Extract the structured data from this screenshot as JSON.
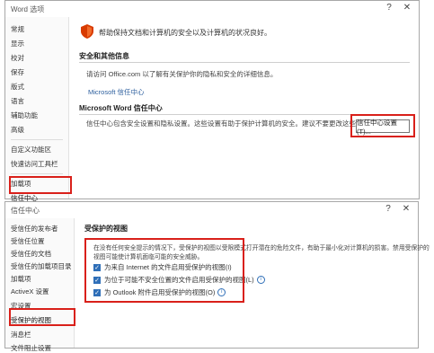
{
  "word_options": {
    "title": "Word 选项",
    "help_btn": "?",
    "close_btn": "✕",
    "sidebar": [
      {
        "label": "常规"
      },
      {
        "label": "显示"
      },
      {
        "label": "校对"
      },
      {
        "label": "保存"
      },
      {
        "label": "版式"
      },
      {
        "label": "语言"
      },
      {
        "label": "辅助功能"
      },
      {
        "label": "高级"
      },
      {
        "label": "自定义功能区"
      },
      {
        "label": "快速访问工具栏"
      },
      {
        "label": "加载项"
      },
      {
        "label": "信任中心"
      }
    ],
    "banner_text": "帮助保持文档和计算机的安全以及计算机的状况良好。",
    "section1_heading": "安全和其他信息",
    "section1_text": "请访问 Office.com 以了解有关保护你的隐私和安全的详细信息。",
    "section1_link": "Microsoft 信任中心",
    "section2_heading": "Microsoft Word 信任中心",
    "section2_text": "信任中心包含安全设置和隐私设置。这些设置有助于保护计算机的安全。建议不要更改这些设置。",
    "trust_center_button": "信任中心设置(T)...",
    "shield_color": "#d83b01",
    "highlight_color": "#d9201a"
  },
  "trust_center": {
    "title": "信任中心",
    "help_btn": "?",
    "close_btn": "✕",
    "sidebar": [
      {
        "label": "受信任的发布者"
      },
      {
        "label": "受信任位置"
      },
      {
        "label": "受信任的文档"
      },
      {
        "label": "受信任的加载项目录"
      },
      {
        "label": "加载项"
      },
      {
        "label": "ActiveX 设置"
      },
      {
        "label": "宏设置"
      },
      {
        "label": "受保护的视图"
      },
      {
        "label": "消息栏"
      },
      {
        "label": "文件阻止设置"
      }
    ],
    "heading": "受保护的视图",
    "description_line1": "在没有任何安全提示的情况下，受保护的视图以受限模式打开潜在的危险文件，有助于最小化对计算机的损害。禁用受保护的",
    "description_line2": "视图可能使计算机面临可能的安全威胁。",
    "options": [
      {
        "label": "为来自 Internet 的文件启用受保护的视图(I)",
        "checked": true,
        "info": false
      },
      {
        "label": "为位于可能不安全位置的文件启用受保护的视图(L)",
        "checked": true,
        "info": true
      },
      {
        "label": "为 Outlook 附件启用受保护的视图(O)",
        "checked": true,
        "info": true
      }
    ],
    "info_glyph": "i",
    "check_glyph": "✓"
  }
}
